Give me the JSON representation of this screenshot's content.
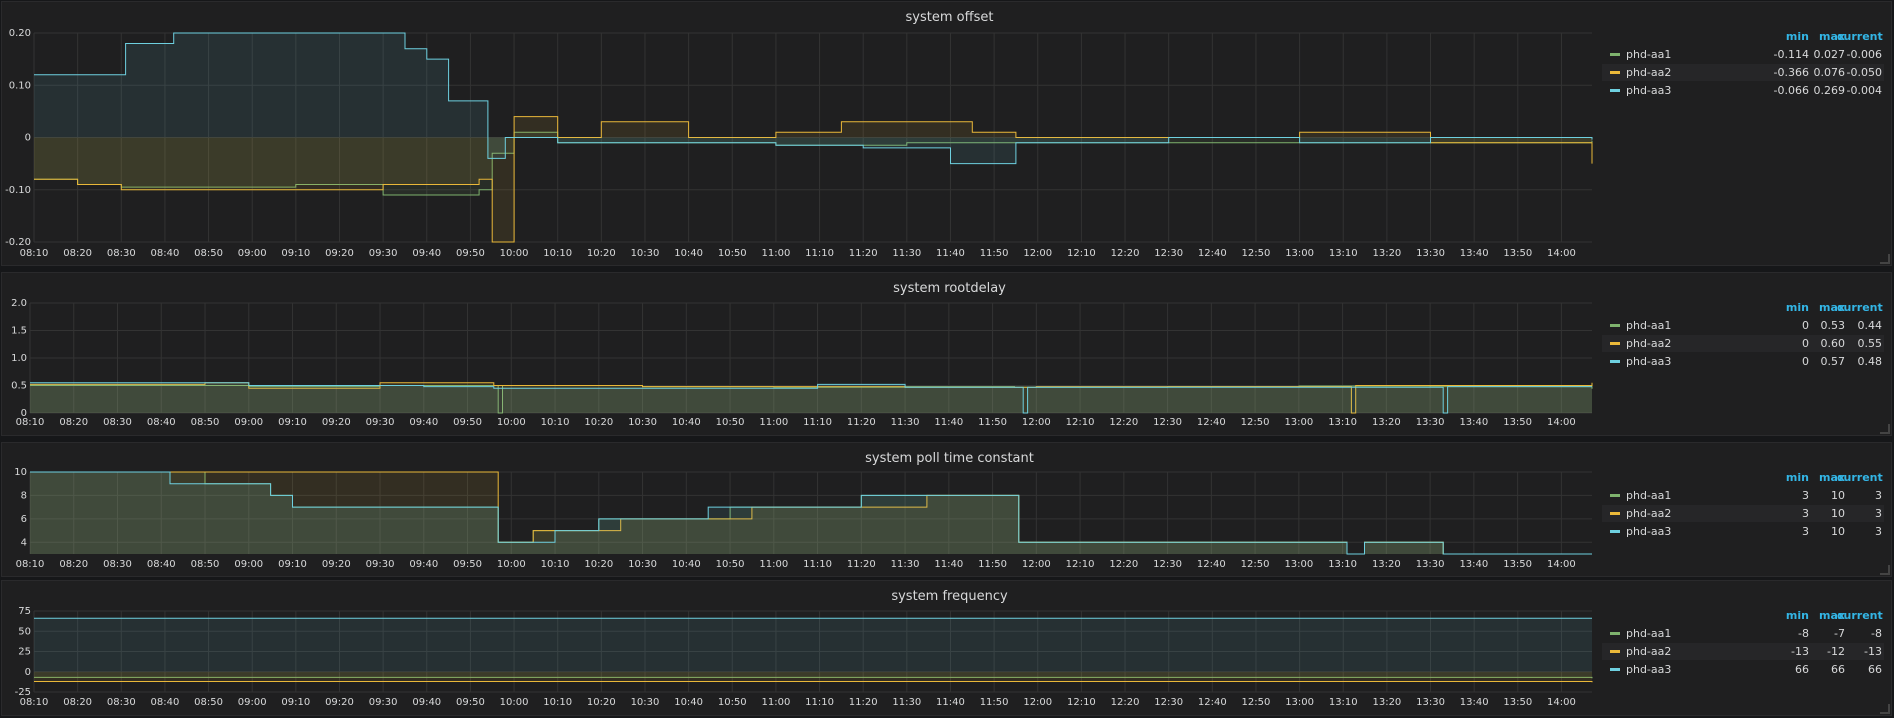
{
  "legend_columns": {
    "min": "min",
    "max": "max",
    "current": "current"
  },
  "colors": {
    "series1": "#7eb26d",
    "series2": "#eab839",
    "series3": "#6ed0e0",
    "grid": "#333333",
    "axis_text": "#d8d9da"
  },
  "x_ticks": [
    "08:10",
    "08:20",
    "08:30",
    "08:40",
    "08:50",
    "09:00",
    "09:10",
    "09:20",
    "09:30",
    "09:40",
    "09:50",
    "10:00",
    "10:10",
    "10:20",
    "10:30",
    "10:40",
    "10:50",
    "11:00",
    "11:10",
    "11:20",
    "11:30",
    "11:40",
    "11:50",
    "12:00",
    "12:10",
    "12:20",
    "12:30",
    "12:40",
    "12:50",
    "13:00",
    "13:10",
    "13:20",
    "13:30",
    "13:40",
    "13:50",
    "14:00"
  ],
  "panels": [
    {
      "title": "system offset",
      "legend": [
        {
          "name": "phd-aa1",
          "min": "-0.114",
          "max": "0.027",
          "current": "-0.006"
        },
        {
          "name": "phd-aa2",
          "min": "-0.366",
          "max": "0.076",
          "current": "-0.050"
        },
        {
          "name": "phd-aa3",
          "min": "-0.066",
          "max": "0.269",
          "current": "-0.004"
        }
      ]
    },
    {
      "title": "system rootdelay",
      "legend": [
        {
          "name": "phd-aa1",
          "min": "0",
          "max": "0.53",
          "current": "0.44"
        },
        {
          "name": "phd-aa2",
          "min": "0",
          "max": "0.60",
          "current": "0.55"
        },
        {
          "name": "phd-aa3",
          "min": "0",
          "max": "0.57",
          "current": "0.48"
        }
      ]
    },
    {
      "title": "system poll time constant",
      "legend": [
        {
          "name": "phd-aa1",
          "min": "3",
          "max": "10",
          "current": "3"
        },
        {
          "name": "phd-aa2",
          "min": "3",
          "max": "10",
          "current": "3"
        },
        {
          "name": "phd-aa3",
          "min": "3",
          "max": "10",
          "current": "3"
        }
      ]
    },
    {
      "title": "system frequency",
      "legend": [
        {
          "name": "phd-aa1",
          "min": "-8",
          "max": "-7",
          "current": "-8"
        },
        {
          "name": "phd-aa2",
          "min": "-13",
          "max": "-12",
          "current": "-13"
        },
        {
          "name": "phd-aa3",
          "min": "66",
          "max": "66",
          "current": "66"
        }
      ]
    }
  ],
  "chart_data": [
    {
      "type": "area",
      "title": "system offset",
      "x_range": [
        "08:10",
        "14:07"
      ],
      "ylim": [
        -0.2,
        0.2
      ],
      "yticks": [
        "0.20",
        "0.10",
        "0",
        "-0.10",
        "-0.20"
      ],
      "y_tick_values": [
        0.2,
        0.1,
        0,
        -0.1,
        -0.2
      ],
      "series": [
        {
          "name": "phd-aa1",
          "min": -0.114,
          "max": 0.027,
          "current": -0.006,
          "points": [
            [
              "08:10",
              -0.08
            ],
            [
              "08:20",
              -0.09
            ],
            [
              "08:30",
              -0.095
            ],
            [
              "09:00",
              -0.095
            ],
            [
              "09:10",
              -0.09
            ],
            [
              "09:30",
              -0.11
            ],
            [
              "09:45",
              -0.11
            ],
            [
              "09:52",
              -0.1
            ],
            [
              "09:55",
              -0.03
            ],
            [
              "10:00",
              0.01
            ],
            [
              "10:10",
              -0.01
            ],
            [
              "10:30",
              -0.01
            ],
            [
              "11:00",
              -0.015
            ],
            [
              "11:30",
              -0.01
            ],
            [
              "11:55",
              -0.01
            ],
            [
              "12:30",
              -0.01
            ],
            [
              "13:00",
              -0.01
            ],
            [
              "13:30",
              -0.01
            ],
            [
              "14:07",
              -0.006
            ]
          ]
        },
        {
          "name": "phd-aa2",
          "min": -0.366,
          "max": 0.076,
          "current": -0.05,
          "points": [
            [
              "08:10",
              -0.08
            ],
            [
              "08:20",
              -0.09
            ],
            [
              "08:30",
              -0.1
            ],
            [
              "09:00",
              -0.1
            ],
            [
              "09:10",
              -0.1
            ],
            [
              "09:30",
              -0.09
            ],
            [
              "09:52",
              -0.08
            ],
            [
              "09:55",
              -0.2
            ],
            [
              "09:58",
              -0.2
            ],
            [
              "10:00",
              0.04
            ],
            [
              "10:10",
              0.0
            ],
            [
              "10:20",
              0.03
            ],
            [
              "10:40",
              0.0
            ],
            [
              "11:00",
              0.01
            ],
            [
              "11:15",
              0.03
            ],
            [
              "11:45",
              0.01
            ],
            [
              "11:55",
              0.0
            ],
            [
              "12:30",
              0.0
            ],
            [
              "13:00",
              0.01
            ],
            [
              "13:30",
              -0.01
            ],
            [
              "14:07",
              -0.05
            ]
          ]
        },
        {
          "name": "phd-aa3",
          "min": -0.066,
          "max": 0.269,
          "current": -0.004,
          "points": [
            [
              "08:10",
              0.12
            ],
            [
              "08:30",
              0.12
            ],
            [
              "08:31",
              0.18
            ],
            [
              "08:42",
              0.2
            ],
            [
              "09:30",
              0.2
            ],
            [
              "09:35",
              0.17
            ],
            [
              "09:40",
              0.15
            ],
            [
              "09:45",
              0.07
            ],
            [
              "09:52",
              0.07
            ],
            [
              "09:54",
              -0.04
            ],
            [
              "09:58",
              0.0
            ],
            [
              "10:10",
              -0.01
            ],
            [
              "10:30",
              -0.01
            ],
            [
              "11:00",
              -0.015
            ],
            [
              "11:20",
              -0.02
            ],
            [
              "11:40",
              -0.05
            ],
            [
              "11:52",
              -0.05
            ],
            [
              "11:55",
              -0.01
            ],
            [
              "12:30",
              0.0
            ],
            [
              "13:00",
              -0.01
            ],
            [
              "13:30",
              0.0
            ],
            [
              "14:07",
              -0.004
            ]
          ]
        }
      ]
    },
    {
      "type": "area",
      "title": "system rootdelay",
      "x_range": [
        "08:10",
        "14:07"
      ],
      "ylim": [
        0,
        2.0
      ],
      "yticks": [
        "2.0",
        "1.5",
        "1.0",
        "0.5",
        "0"
      ],
      "y_tick_values": [
        2.0,
        1.5,
        1.0,
        0.5,
        0
      ],
      "series": [
        {
          "name": "phd-aa1",
          "min": 0,
          "max": 0.53,
          "current": 0.44,
          "points": [
            [
              "08:10",
              0.5
            ],
            [
              "09:00",
              0.48
            ],
            [
              "09:30",
              0.5
            ],
            [
              "09:56",
              0.5
            ],
            [
              "09:57",
              0.0
            ],
            [
              "09:58",
              0.5
            ],
            [
              "10:30",
              0.48
            ],
            [
              "11:00",
              0.47
            ],
            [
              "11:30",
              0.48
            ],
            [
              "11:55",
              0.47
            ],
            [
              "12:30",
              0.48
            ],
            [
              "13:00",
              0.49
            ],
            [
              "13:30",
              0.48
            ],
            [
              "14:07",
              0.44
            ]
          ]
        },
        {
          "name": "phd-aa2",
          "min": 0,
          "max": 0.6,
          "current": 0.55,
          "points": [
            [
              "08:10",
              0.52
            ],
            [
              "08:50",
              0.55
            ],
            [
              "09:00",
              0.45
            ],
            [
              "09:30",
              0.55
            ],
            [
              "09:56",
              0.5
            ],
            [
              "10:30",
              0.48
            ],
            [
              "11:00",
              0.48
            ],
            [
              "11:30",
              0.47
            ],
            [
              "12:00",
              0.48
            ],
            [
              "13:11",
              0.48
            ],
            [
              "13:12",
              0.0
            ],
            [
              "13:13",
              0.5
            ],
            [
              "13:40",
              0.5
            ],
            [
              "14:07",
              0.55
            ]
          ]
        },
        {
          "name": "phd-aa3",
          "min": 0,
          "max": 0.57,
          "current": 0.48,
          "points": [
            [
              "08:10",
              0.55
            ],
            [
              "08:30",
              0.55
            ],
            [
              "09:00",
              0.5
            ],
            [
              "09:40",
              0.48
            ],
            [
              "09:56",
              0.45
            ],
            [
              "10:30",
              0.45
            ],
            [
              "11:10",
              0.52
            ],
            [
              "11:30",
              0.47
            ],
            [
              "11:56",
              0.47
            ],
            [
              "11:57",
              0.0
            ],
            [
              "11:58",
              0.47
            ],
            [
              "12:30",
              0.47
            ],
            [
              "13:32",
              0.47
            ],
            [
              "13:33",
              0.0
            ],
            [
              "13:34",
              0.48
            ],
            [
              "14:07",
              0.48
            ]
          ]
        }
      ]
    },
    {
      "type": "area",
      "title": "system poll time constant",
      "x_range": [
        "08:10",
        "14:07"
      ],
      "ylim": [
        3,
        10
      ],
      "yticks": [
        "10",
        "8",
        "6",
        "4"
      ],
      "y_tick_values": [
        10,
        8,
        6,
        4
      ],
      "series": [
        {
          "name": "phd-aa1",
          "min": 3,
          "max": 10,
          "current": 3,
          "points": [
            [
              "08:10",
              10
            ],
            [
              "08:45",
              10
            ],
            [
              "08:50",
              9
            ],
            [
              "09:05",
              8
            ],
            [
              "09:10",
              7
            ],
            [
              "09:56",
              7
            ],
            [
              "09:57",
              4
            ],
            [
              "10:05",
              5
            ],
            [
              "10:15",
              5
            ],
            [
              "10:20",
              6
            ],
            [
              "10:45",
              6
            ],
            [
              "10:50",
              7
            ],
            [
              "11:15",
              7
            ],
            [
              "11:20",
              8
            ],
            [
              "11:55",
              8
            ],
            [
              "11:56",
              4
            ],
            [
              "13:10",
              4
            ],
            [
              "13:11",
              3
            ],
            [
              "13:15",
              4
            ],
            [
              "13:32",
              4
            ],
            [
              "13:33",
              3
            ],
            [
              "14:07",
              3
            ]
          ]
        },
        {
          "name": "phd-aa2",
          "min": 3,
          "max": 10,
          "current": 3,
          "points": [
            [
              "08:10",
              10
            ],
            [
              "09:56",
              10
            ],
            [
              "09:57",
              4
            ],
            [
              "10:05",
              5
            ],
            [
              "10:25",
              6
            ],
            [
              "10:50",
              6
            ],
            [
              "10:55",
              7
            ],
            [
              "11:30",
              7
            ],
            [
              "11:35",
              8
            ],
            [
              "11:55",
              8
            ],
            [
              "11:56",
              4
            ],
            [
              "13:10",
              4
            ],
            [
              "13:11",
              3
            ],
            [
              "13:15",
              4
            ],
            [
              "13:32",
              4
            ],
            [
              "13:33",
              3
            ],
            [
              "14:07",
              3
            ]
          ]
        },
        {
          "name": "phd-aa3",
          "min": 3,
          "max": 10,
          "current": 3,
          "points": [
            [
              "08:10",
              10
            ],
            [
              "08:40",
              10
            ],
            [
              "08:42",
              9
            ],
            [
              "09:05",
              8
            ],
            [
              "09:10",
              7
            ],
            [
              "09:56",
              7
            ],
            [
              "09:57",
              4
            ],
            [
              "10:05",
              4
            ],
            [
              "10:10",
              5
            ],
            [
              "10:20",
              6
            ],
            [
              "10:45",
              7
            ],
            [
              "11:15",
              7
            ],
            [
              "11:20",
              8
            ],
            [
              "11:55",
              8
            ],
            [
              "11:56",
              4
            ],
            [
              "13:10",
              4
            ],
            [
              "13:11",
              3
            ],
            [
              "13:15",
              4
            ],
            [
              "13:32",
              4
            ],
            [
              "13:33",
              3
            ],
            [
              "14:07",
              3
            ]
          ]
        }
      ]
    },
    {
      "type": "area",
      "title": "system frequency",
      "x_range": [
        "08:10",
        "14:07"
      ],
      "ylim": [
        -25,
        75
      ],
      "yticks": [
        "75",
        "50",
        "25",
        "0",
        "-25"
      ],
      "y_tick_values": [
        75,
        50,
        25,
        0,
        -25
      ],
      "series": [
        {
          "name": "phd-aa1",
          "min": -8,
          "max": -7,
          "current": -8,
          "points": [
            [
              "08:10",
              -7
            ],
            [
              "14:07",
              -8
            ]
          ]
        },
        {
          "name": "phd-aa2",
          "min": -13,
          "max": -12,
          "current": -13,
          "points": [
            [
              "08:10",
              -12
            ],
            [
              "14:07",
              -13
            ]
          ]
        },
        {
          "name": "phd-aa3",
          "min": 66,
          "max": 66,
          "current": 66,
          "points": [
            [
              "08:10",
              66
            ],
            [
              "14:07",
              66
            ]
          ]
        }
      ]
    }
  ]
}
